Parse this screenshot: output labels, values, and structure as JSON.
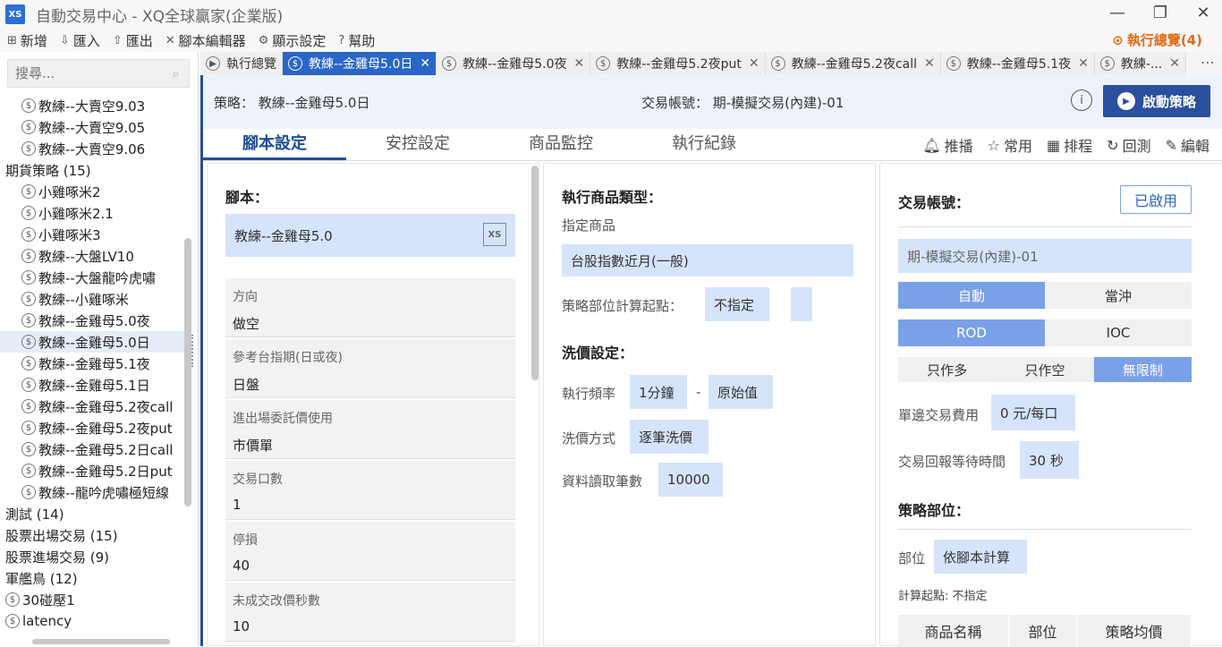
{
  "window": {
    "title": "自動交易中心 - XQ全球贏家(企業版)",
    "logo": "XS"
  },
  "menu": {
    "items": [
      {
        "icon": "new-icon",
        "glyph": "⊞",
        "label": "新增"
      },
      {
        "icon": "import-icon",
        "glyph": "⇩",
        "label": "匯入"
      },
      {
        "icon": "export-icon",
        "glyph": "⇧",
        "label": "匯出"
      },
      {
        "icon": "script-editor-icon",
        "glyph": "✕",
        "label": "腳本編輯器"
      },
      {
        "icon": "gear-icon",
        "glyph": "⚙",
        "label": "顯示設定"
      },
      {
        "icon": "help-icon",
        "glyph": "?",
        "label": "幫助"
      }
    ],
    "run_overview": "執行總覽(4)"
  },
  "sidebar": {
    "search_placeholder": "搜尋...",
    "tree": [
      {
        "type": "child",
        "label": "教練--大賣空9.03"
      },
      {
        "type": "child",
        "label": "教練--大賣空9.05"
      },
      {
        "type": "child",
        "label": "教練--大賣空9.06"
      },
      {
        "type": "group",
        "label": "期貨策略 (15)"
      },
      {
        "type": "child",
        "label": "小雞啄米2"
      },
      {
        "type": "child",
        "label": "小雞啄米2.1"
      },
      {
        "type": "child",
        "label": "小雞啄米3"
      },
      {
        "type": "child",
        "label": "教練--大盤LV10"
      },
      {
        "type": "child",
        "label": "教練--大盤龍吟虎嘯"
      },
      {
        "type": "child",
        "label": "教練--小雞啄米"
      },
      {
        "type": "child",
        "label": "教練--金雞母5.0夜"
      },
      {
        "type": "child",
        "label": "教練--金雞母5.0日",
        "selected": true
      },
      {
        "type": "child",
        "label": "教練--金雞母5.1夜"
      },
      {
        "type": "child",
        "label": "教練--金雞母5.1日"
      },
      {
        "type": "child",
        "label": "教練--金雞母5.2夜call"
      },
      {
        "type": "child",
        "label": "教練--金雞母5.2夜put"
      },
      {
        "type": "child",
        "label": "教練--金雞母5.2日call"
      },
      {
        "type": "child",
        "label": "教練--金雞母5.2日put"
      },
      {
        "type": "child",
        "label": "教練--龍吟虎嘯極短線"
      },
      {
        "type": "group",
        "label": "測試 (14)"
      },
      {
        "type": "group",
        "label": "股票出場交易 (15)"
      },
      {
        "type": "group",
        "label": "股票進場交易 (9)"
      },
      {
        "type": "group",
        "label": "軍艦鳥 (12)"
      },
      {
        "type": "leaf",
        "label": "30碰壓1"
      },
      {
        "type": "leaf",
        "label": "latency"
      }
    ]
  },
  "tabs": [
    {
      "label": "執行總覽",
      "icon": "play-icon",
      "closable": false,
      "active": false
    },
    {
      "label": "教練--金雞母5.0日",
      "icon": "dollar-icon",
      "closable": true,
      "active": true
    },
    {
      "label": "教練--金雞母5.0夜",
      "icon": "dollar-icon",
      "closable": true,
      "active": false
    },
    {
      "label": "教練--金雞母5.2夜put",
      "icon": "dollar-icon",
      "closable": true,
      "active": false
    },
    {
      "label": "教練--金雞母5.2夜call",
      "icon": "dollar-icon",
      "closable": true,
      "active": false
    },
    {
      "label": "教練--金雞母5.1夜",
      "icon": "dollar-icon",
      "closable": true,
      "active": false
    },
    {
      "label": "教練-...",
      "icon": "dollar-icon",
      "closable": true,
      "active": false
    }
  ],
  "header": {
    "strategy": "策略： 教練--金雞母5.0日",
    "account": "交易帳號： 期-模擬交易(內建)-01",
    "start_button": "啟動策略"
  },
  "subtabs": [
    "腳本設定",
    "安控設定",
    "商品監控",
    "執行紀錄"
  ],
  "sub_actions": [
    {
      "icon": "bell-icon",
      "glyph": "🔔︎",
      "label": "推播"
    },
    {
      "icon": "star-icon",
      "glyph": "☆",
      "label": "常用"
    },
    {
      "icon": "calendar-icon",
      "glyph": "▦",
      "label": "排程"
    },
    {
      "icon": "backtest-icon",
      "glyph": "↻",
      "label": "回測"
    },
    {
      "icon": "edit-icon",
      "glyph": "✎",
      "label": "編輯"
    }
  ],
  "script_panel": {
    "title": "腳本：",
    "script_name": "教練--金雞母5.0",
    "props": [
      {
        "k": "方向",
        "v": "做空"
      },
      {
        "k": "參考台指期(日或夜)",
        "v": "日盤"
      },
      {
        "k": "進出場委託價使用",
        "v": "市價單"
      },
      {
        "k": "交易口數",
        "v": "1"
      },
      {
        "k": "停損",
        "v": "40"
      },
      {
        "k": "未成交改價秒數",
        "v": "10"
      }
    ]
  },
  "product_panel": {
    "title": "執行商品類型：",
    "subtitle": "指定商品",
    "product": "台股指數近月(一般)",
    "calc_label": "策略部位計算起點：",
    "calc_value": "不指定",
    "price_title": "洗價設定：",
    "freq_label": "執行頻率",
    "freq_value": "1分鐘",
    "dash": "-",
    "freq_value2": "原始值",
    "method_label": "洗價方式",
    "method_value": "逐筆洗價",
    "read_label": "資料讀取筆數",
    "read_value": "10000"
  },
  "account_panel": {
    "title": "交易帳號：",
    "enabled": "已啟用",
    "account": "期-模擬交易(內建)-01",
    "mode": [
      "自動",
      "當沖"
    ],
    "order": [
      "ROD",
      "IOC"
    ],
    "side": [
      "只作多",
      "只作空",
      "無限制"
    ],
    "fee_label": "單邊交易費用",
    "fee_value": "0 元/每口",
    "wait_label": "交易回報等待時間",
    "wait_value": "30 秒",
    "position_title": "策略部位：",
    "position_label": "部位",
    "position_value": "依腳本計算",
    "calc_point": "計算起點: 不指定",
    "table_headers": [
      "商品名稱",
      "部位",
      "策略均價"
    ]
  }
}
